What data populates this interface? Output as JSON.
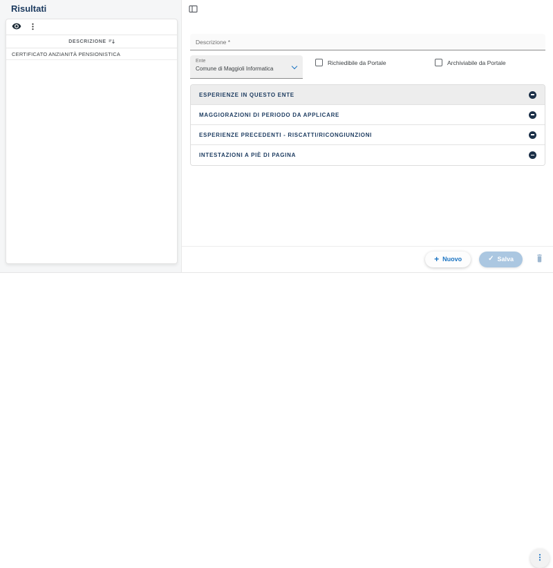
{
  "left_panel": {
    "title": "Risultati",
    "table": {
      "column_header": "DESCRIZIONE",
      "rows": [
        "CERTIFICATO ANZIANITÀ PENSIONISTICA"
      ]
    }
  },
  "form": {
    "descrizione": {
      "label": "Descrizione *",
      "value": ""
    },
    "ente": {
      "label": "Ente",
      "value": "Comune di Maggioli Informatica"
    },
    "checkboxes": [
      {
        "label": "Richiedibile da Portale",
        "checked": false
      },
      {
        "label": "Archiviabile da Portale",
        "checked": false
      }
    ],
    "sections": [
      "ESPERIENZE IN QUESTO ENTE",
      "MAGGIORAZIONI DI PERIODO DA APPLICARE",
      "ESPERIENZE PRECEDENTI - RISCATTI/RICONGIUNZIONI",
      "INTESTAZIONI A PIÈ DI PAGINA"
    ]
  },
  "actions": {
    "nuovo_label": "Nuovo",
    "salva_label": "Salva"
  },
  "icons": {
    "plus_glyph": "+",
    "check_glyph": "✓",
    "sort_glyph": "↓",
    "names": [
      "eye-icon",
      "kebab-icon",
      "sort-icon",
      "panel-toggle-icon",
      "chevron-down-icon",
      "minus-circle-icon",
      "plus-icon",
      "check-icon",
      "trash-icon",
      "more-vertical-icon"
    ]
  },
  "colors": {
    "accent_blue": "#1a73c2",
    "heading_navy": "#1b3a5f",
    "salva_disabled_bg": "#abc7e1",
    "trash_muted_blue": "#9db7d0",
    "left_region_bg": "#f5f6f7",
    "accordion_first_bg": "#ededed"
  }
}
